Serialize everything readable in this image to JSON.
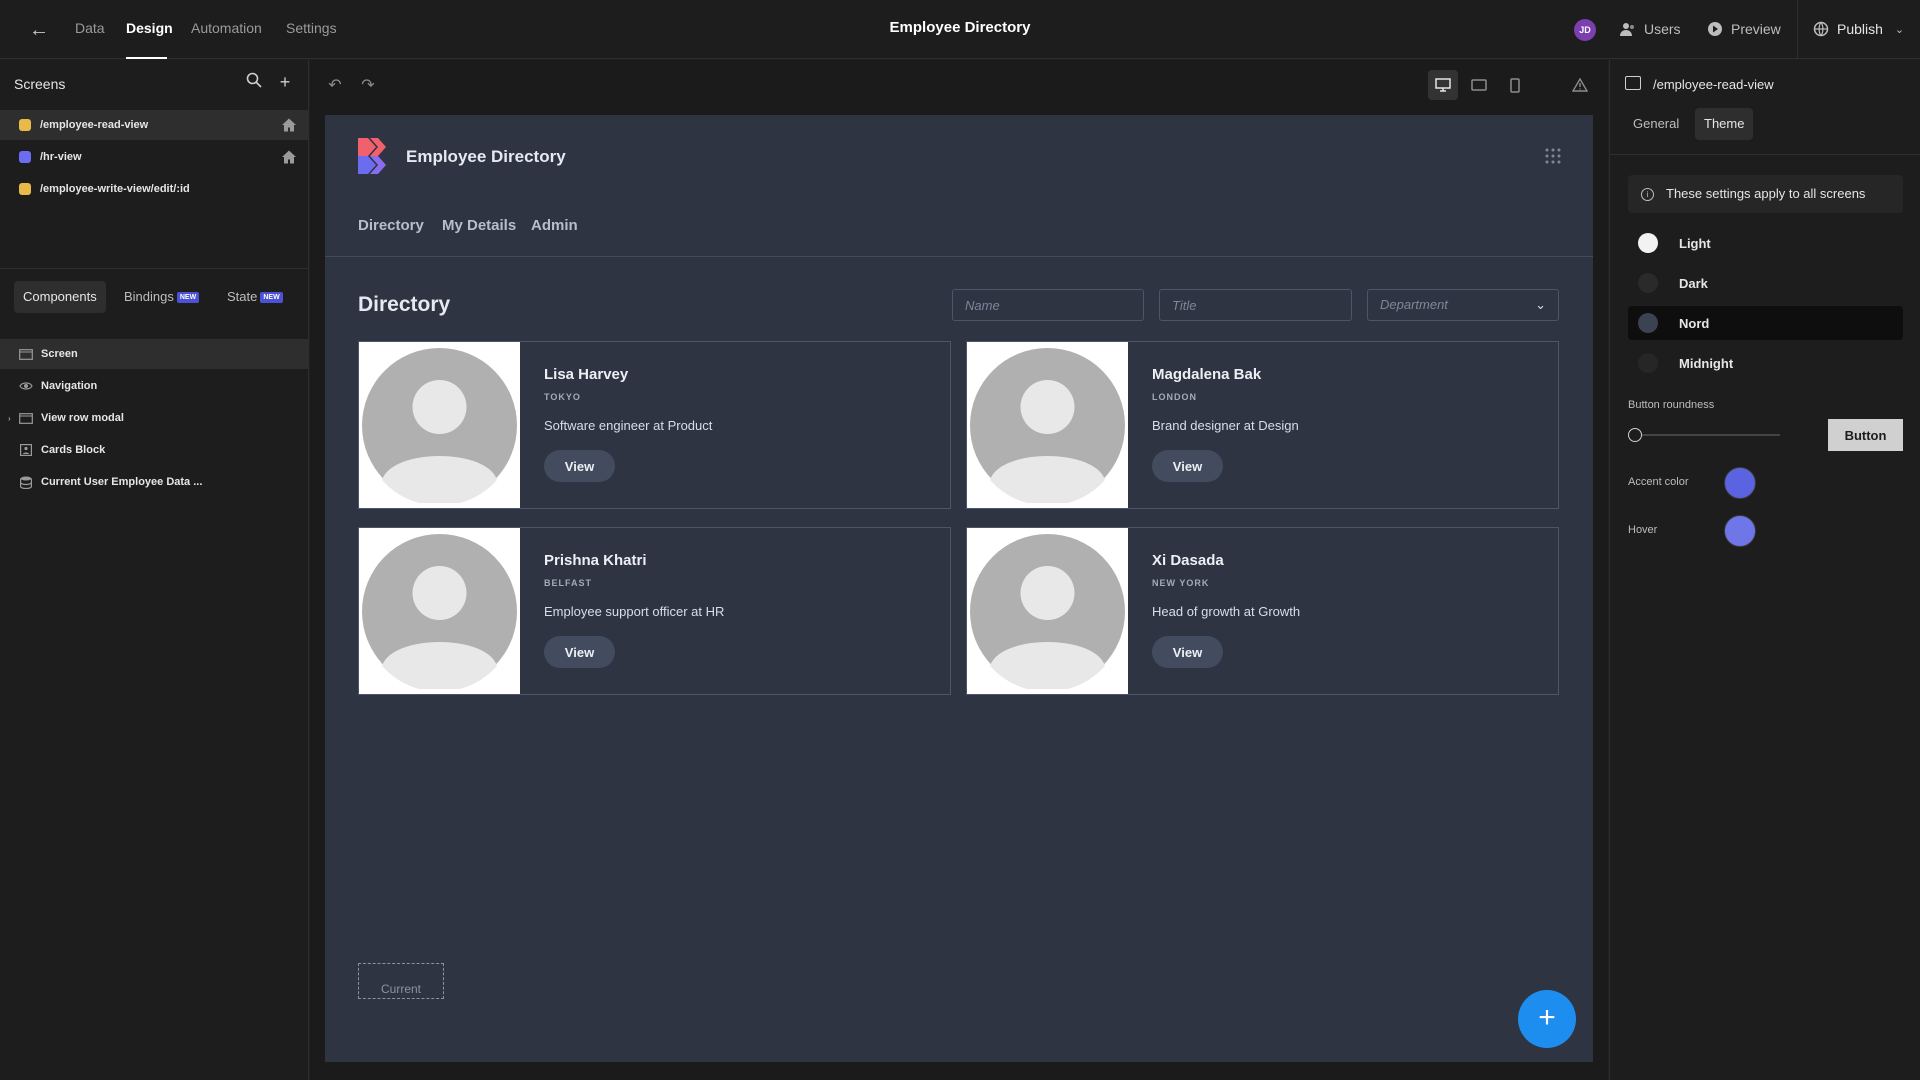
{
  "topbar": {
    "tabs": [
      "Data",
      "Design",
      "Automation",
      "Settings"
    ],
    "active_tab": "Design",
    "title": "Employee Directory",
    "avatar_initials": "JD",
    "users_label": "Users",
    "preview_label": "Preview",
    "publish_label": "Publish"
  },
  "left": {
    "screens_title": "Screens",
    "screens": [
      {
        "route": "/employee-read-view",
        "color": "#e9b949",
        "home": true,
        "selected": true
      },
      {
        "route": "/hr-view",
        "color": "#6c6cf0",
        "home": true,
        "selected": false
      },
      {
        "route": "/employee-write-view/edit/:id",
        "color": "#e9b949",
        "home": false,
        "selected": false
      }
    ],
    "tabs": {
      "components": "Components",
      "bindings": "Bindings",
      "state": "State",
      "new_badge": "NEW"
    },
    "tree": [
      {
        "label": "Screen",
        "icon": "screen-icon",
        "selected": true
      },
      {
        "label": "Navigation",
        "icon": "eye-icon",
        "selected": false
      },
      {
        "label": "View row modal",
        "icon": "modal-icon",
        "selected": false
      },
      {
        "label": "Cards Block",
        "icon": "cards-icon",
        "selected": false
      },
      {
        "label": "Current User Employee Data ...",
        "icon": "database-icon",
        "selected": false
      }
    ]
  },
  "preview": {
    "brand": "Employee Directory",
    "nav": [
      "Directory",
      "My Details",
      "Admin"
    ],
    "section_title": "Directory",
    "filters": {
      "name": "Name",
      "title": "Title",
      "department": "Department"
    },
    "cards": [
      {
        "name": "Lisa Harvey",
        "location": "TOKYO",
        "role": "Software engineer at Product",
        "button": "View"
      },
      {
        "name": "Magdalena Bak",
        "location": "LONDON",
        "role": "Brand designer at Design",
        "button": "View"
      },
      {
        "name": "Prishna Khatri",
        "location": "BELFAST",
        "role": "Employee support officer at HR",
        "button": "View"
      },
      {
        "name": "Xi Dasada",
        "location": "NEW YORK",
        "role": "Head of growth at Growth",
        "button": "View"
      }
    ],
    "current_placeholder": "Current"
  },
  "right": {
    "route": "/employee-read-view",
    "tabs": [
      "General",
      "Theme"
    ],
    "active_tab": "Theme",
    "info": "These settings apply to all screens",
    "themes": [
      {
        "label": "Light",
        "color": "#f2f2f2",
        "selected": false
      },
      {
        "label": "Dark",
        "color": "#2a2a2a",
        "selected": false
      },
      {
        "label": "Nord",
        "color": "#3b4252",
        "selected": true
      },
      {
        "label": "Midnight",
        "color": "#262626",
        "selected": false
      }
    ],
    "button_roundness_label": "Button roundness",
    "button_label": "Button",
    "accent_label": "Accent color",
    "accent_color": "#5b63e0",
    "hover_label": "Hover",
    "hover_color": "#6f76e8"
  }
}
